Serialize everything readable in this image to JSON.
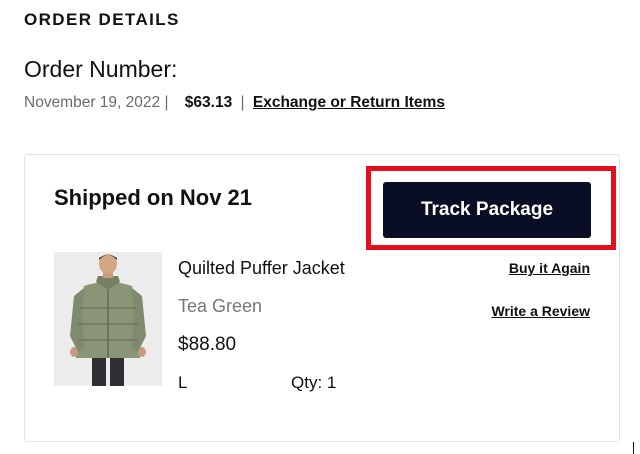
{
  "header": {
    "section_title": "ORDER DETAILS",
    "order_number_label": "Order Number:"
  },
  "order": {
    "date": "November 19, 2022",
    "separator": "|",
    "total": "$63.13",
    "exchange_link": "Exchange or Return Items"
  },
  "shipment": {
    "status": "Shipped on Nov 21",
    "track_button": "Track Package"
  },
  "item": {
    "name": "Quilted Puffer Jacket",
    "color": "Tea Green",
    "price": "$88.80",
    "size": "L",
    "qty": "Qty: 1",
    "image_icon": "jacket-product-photo",
    "buy_again": "Buy it Again",
    "write_review": "Write a Review"
  },
  "colors": {
    "button_bg": "#0a0e24",
    "highlight": "#e3101b",
    "muted_text": "#6b6b6b"
  }
}
